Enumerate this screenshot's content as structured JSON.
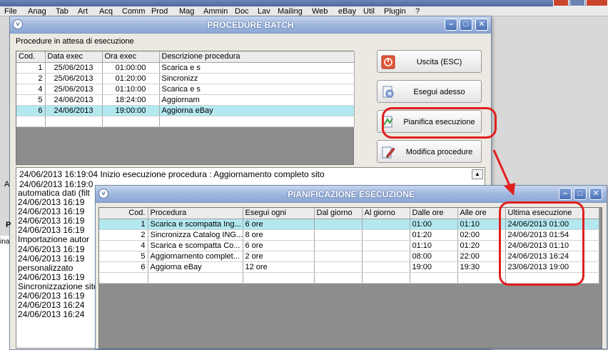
{
  "app": {
    "menu": [
      "File",
      "Anag",
      "Tab",
      "Art",
      "Acq",
      "Comm",
      "Prod",
      "Mag",
      "Ammin",
      "Doc",
      "Lav",
      "Mailing",
      "Web",
      "eBay",
      "Util",
      "Plugin",
      "?"
    ]
  },
  "batch": {
    "title": "PROCEDURE BATCH",
    "subtitle": "Procedure in attesa di esecuzione",
    "columns": [
      "Cod.",
      "Data exec",
      "Ora exec",
      "Descrizione procedura"
    ],
    "rows": [
      {
        "cod": "1",
        "date": "25/06/2013",
        "time": "01:00:00",
        "desc": "Scarica e s"
      },
      {
        "cod": "2",
        "date": "25/06/2013",
        "time": "01:20:00",
        "desc": "Sincronizz"
      },
      {
        "cod": "4",
        "date": "25/06/2013",
        "time": "01:10:00",
        "desc": "Scarica e s"
      },
      {
        "cod": "5",
        "date": "24/06/2013",
        "time": "18:24:00",
        "desc": "Aggiornam"
      },
      {
        "cod": "6",
        "date": "24/06/2013",
        "time": "19:00:00",
        "desc": "Aggiorna eBay"
      }
    ],
    "buttons": {
      "exit": "Uscita (ESC)",
      "run": "Esegui adesso",
      "schedule": "Pianifica esecuzione",
      "edit": "Modifica procedure"
    },
    "log": [
      "24/06/2013 16:19:04 Inizio esecuzione procedura : Aggiornamento completo sito",
      "24/06/2013 16:19:0"
    ]
  },
  "bglog": {
    "lines": [
      "automatica dati (filt",
      "24/06/2013 16:19",
      "24/06/2013 16:19",
      "24/06/2013 16:19",
      "24/06/2013 16:19",
      "Importazione autor",
      "24/06/2013 16:19",
      "24/06/2013 16:19",
      "personalizzato",
      "24/06/2013 16:19",
      "Sincronizzazione sito",
      "24/06/2013 16:19",
      "24/06/2013 16:24",
      "24/06/2013 16:24"
    ]
  },
  "sched": {
    "title": "PIANIFICAZIONE ESECUZIONE",
    "columns": [
      "Cod.",
      "Procedura",
      "Esegui ogni",
      "Dal giorno",
      "Al giorno",
      "Dalle ore",
      "Alle ore",
      "Ultima esecuzione"
    ],
    "rows": [
      {
        "cod": "1",
        "proc": "Scarica e scompatta Ing...",
        "every": "6 ore",
        "from_day": "",
        "to_day": "",
        "from_h": "01:00",
        "to_h": "01:10",
        "last": "24/06/2013 01:00"
      },
      {
        "cod": "2",
        "proc": "Sincronizza Catalog ING...",
        "every": "8 ore",
        "from_day": "",
        "to_day": "",
        "from_h": "01:20",
        "to_h": "02:00",
        "last": "24/06/2013 01:54"
      },
      {
        "cod": "4",
        "proc": "Scarica e scompatta Co...",
        "every": "6 ore",
        "from_day": "",
        "to_day": "",
        "from_h": "01:10",
        "to_h": "01:20",
        "last": "24/06/2013 01:10"
      },
      {
        "cod": "5",
        "proc": "Aggiornamento complet...",
        "every": "2 ore",
        "from_day": "",
        "to_day": "",
        "from_h": "08:00",
        "to_h": "22:00",
        "last": "24/06/2013 16:24"
      },
      {
        "cod": "6",
        "proc": "Aggiorna eBay",
        "every": "12 ore",
        "from_day": "",
        "to_day": "",
        "from_h": "19:00",
        "to_h": "19:30",
        "last": "23/06/2013 19:00"
      }
    ]
  },
  "colors": {
    "highlight": "#e0201e",
    "selected_row": "#b3e8f0",
    "title_gradient": "#9fb7de"
  }
}
